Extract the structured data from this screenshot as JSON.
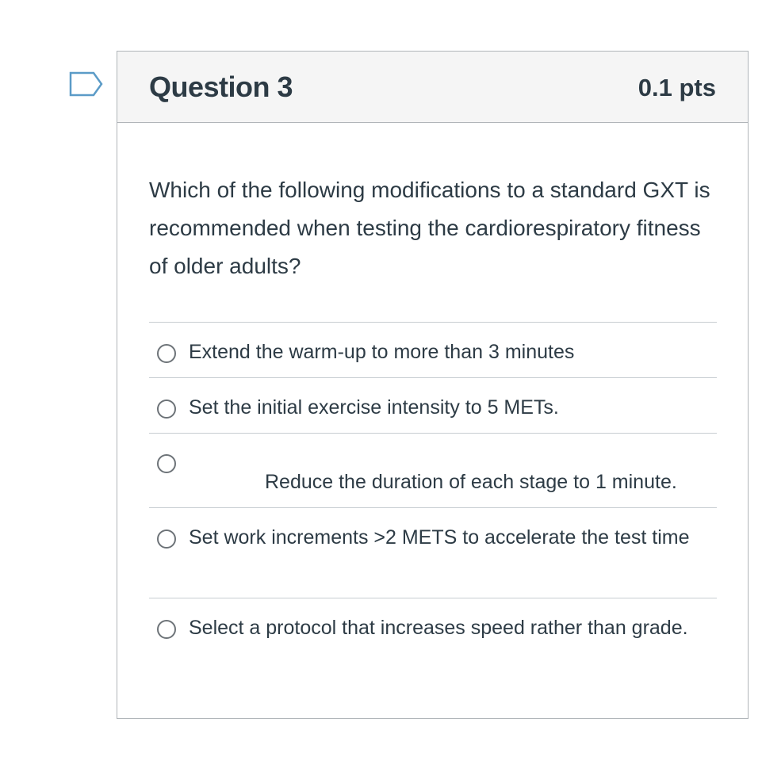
{
  "flag": {
    "icon": "flag-icon",
    "color": "#5b9bc7"
  },
  "question": {
    "title": "Question 3",
    "points": "0.1 pts",
    "text": "Which of the following modifications to a standard GXT is recommended when testing the cardiorespiratory fitness of older adults?"
  },
  "answers": [
    {
      "label": "Extend the warm-up to more than 3 minutes",
      "selected": false
    },
    {
      "label": "Set the initial exercise intensity to 5 METs.",
      "selected": false
    },
    {
      "label": "Reduce the duration of each stage to 1 minute.",
      "selected": false
    },
    {
      "label": "Set work increments >2 METS to accelerate the test time",
      "selected": false
    },
    {
      "label": "Select a protocol that increases speed rather than grade.",
      "selected": false
    }
  ]
}
